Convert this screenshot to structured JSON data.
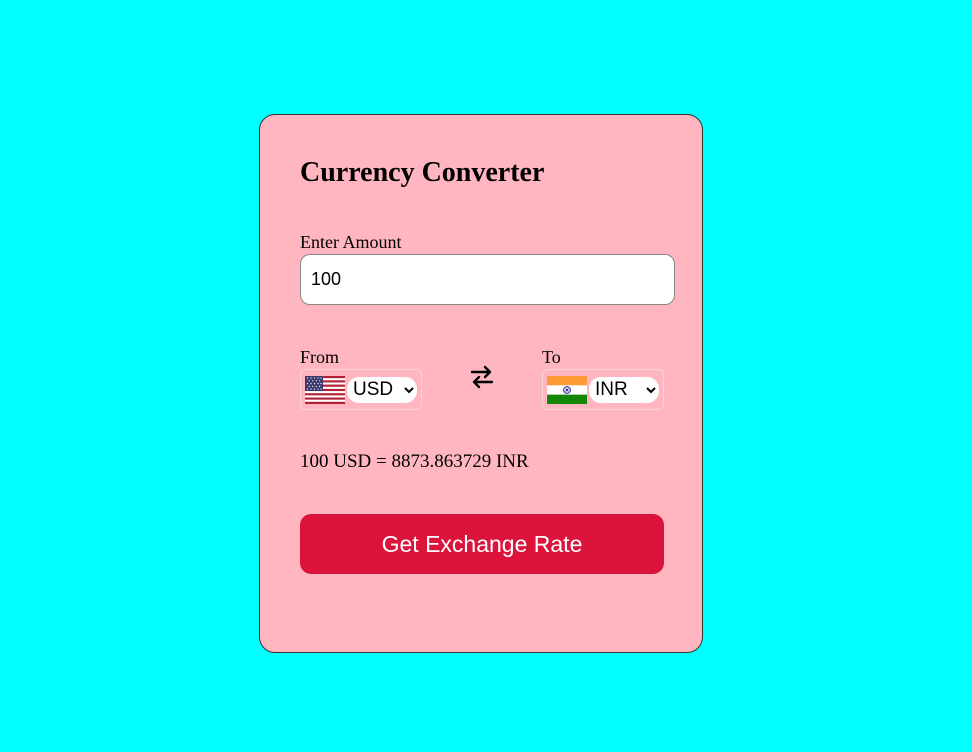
{
  "card": {
    "title": "Currency Converter"
  },
  "amount": {
    "label": "Enter Amount",
    "value": "100"
  },
  "from": {
    "label": "From",
    "currency": "USD",
    "flag_icon": "us-flag-icon"
  },
  "to": {
    "label": "To",
    "currency": "INR",
    "flag_icon": "india-flag-icon"
  },
  "swap": {
    "icon": "swap-arrows-icon"
  },
  "result": {
    "text": "100 USD = 8873.863729 INR"
  },
  "button": {
    "label": "Get Exchange Rate"
  },
  "colors": {
    "page_background": "#00ffff",
    "card_background": "#ffb6c1",
    "button_background": "#dc143c",
    "button_text": "#ffffff"
  }
}
